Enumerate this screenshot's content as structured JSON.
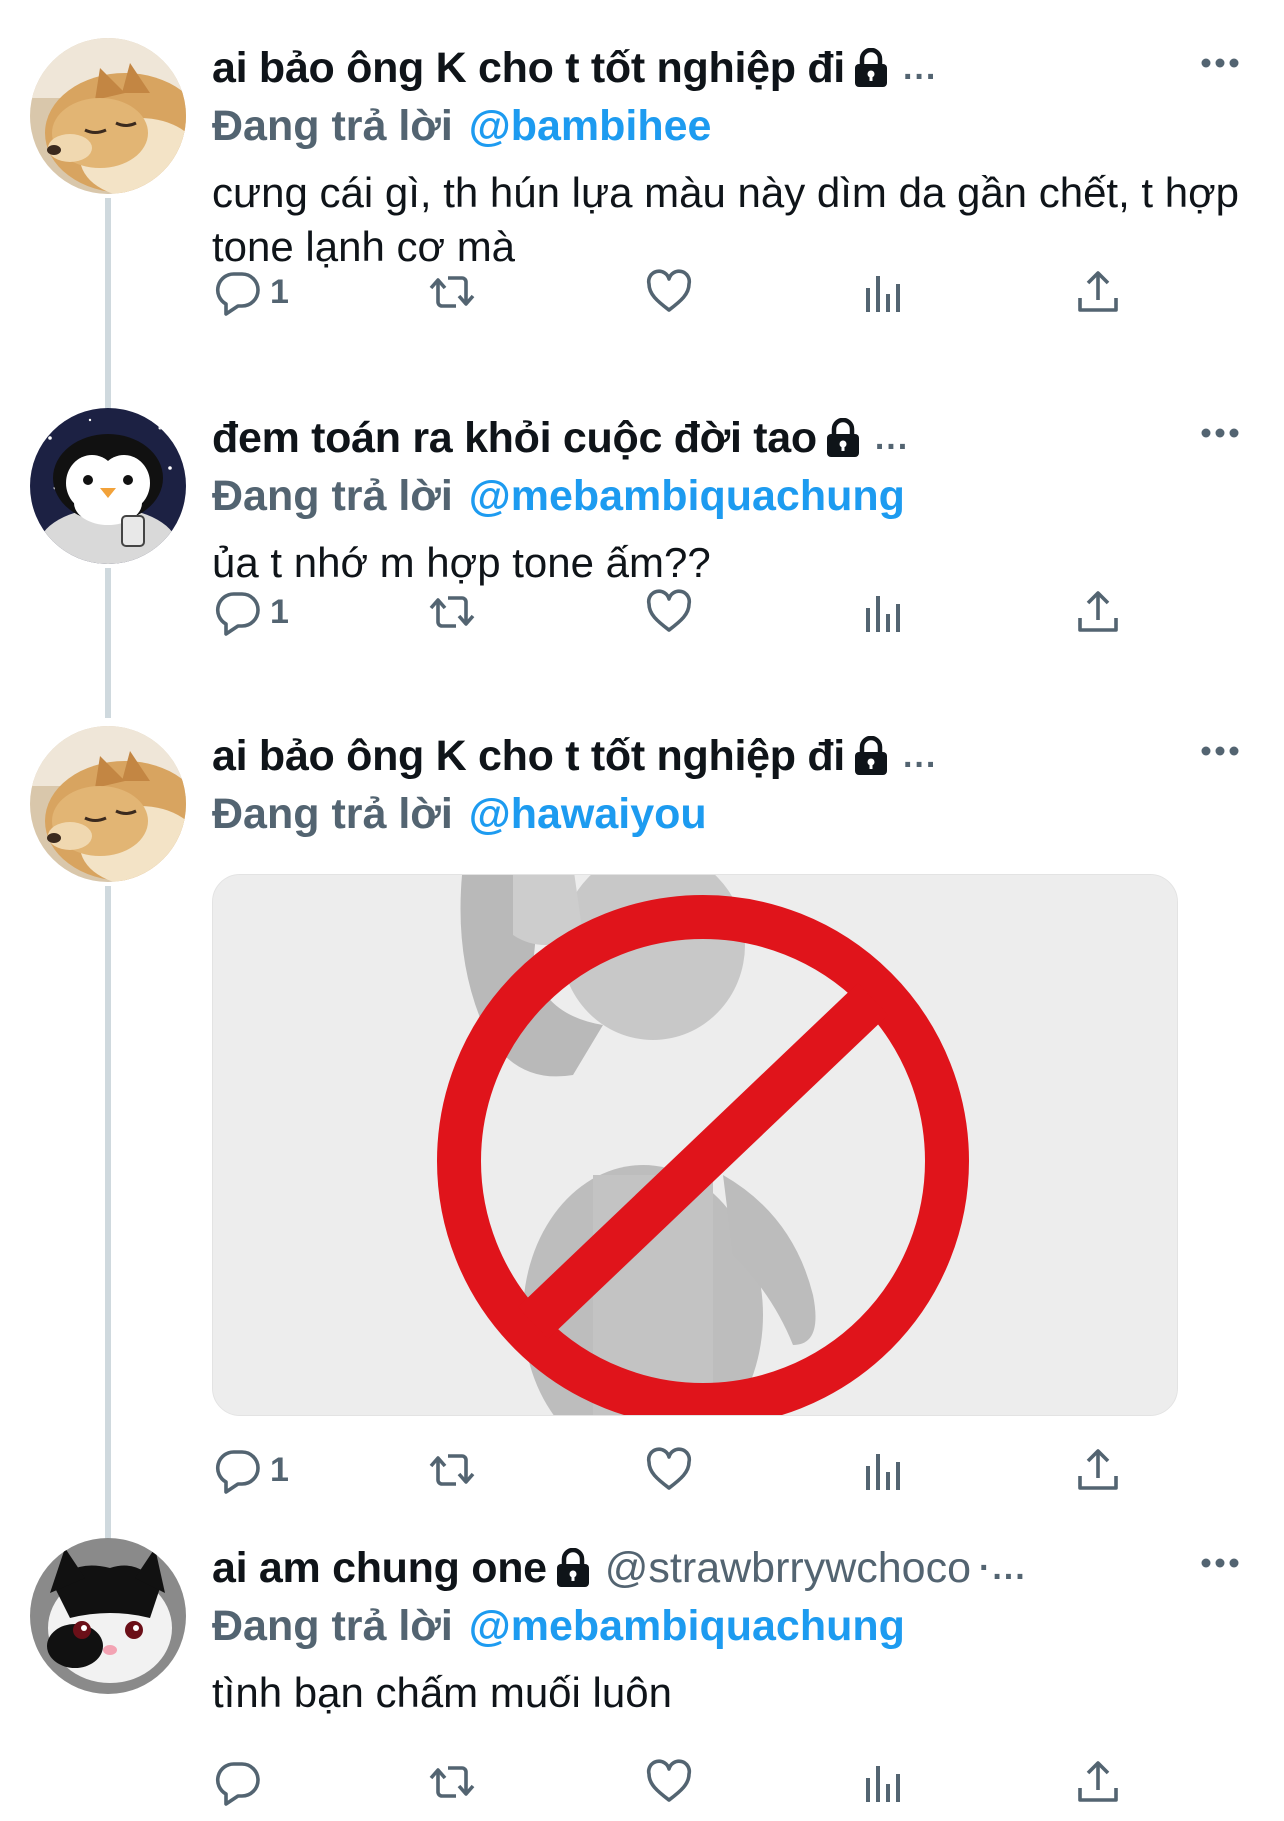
{
  "tweets": [
    {
      "display_name": "ai bảo ông K cho t tốt nghiệp đi",
      "handle": "",
      "truncation": "...",
      "reply_label": "Đang trả lời",
      "reply_to": "@bambihee",
      "text": "cưng cái gì, th hún lựa màu này dìm da gần chết, t hợp tone lạnh cơ mà",
      "reply_count": "1",
      "avatar_icon": "shiba-dog-avatar"
    },
    {
      "display_name": "đem toán ra khỏi cuộc đời tao",
      "handle": "",
      "truncation": "...",
      "reply_label": "Đang trả lời",
      "reply_to": "@mebambiquachung",
      "text": "ủa t nhớ m hợp tone ấm??",
      "reply_count": "1",
      "avatar_icon": "penguin-avatar"
    },
    {
      "display_name": "ai bảo ông K cho t tốt nghiệp đi",
      "handle": "",
      "truncation": "...",
      "reply_label": "Đang trả lời",
      "reply_to": "@hawaiyou",
      "text": "",
      "media_icon": "no-entry-stop-figure-image",
      "reply_count": "1",
      "avatar_icon": "shiba-dog-avatar"
    },
    {
      "display_name": "ai am chung one",
      "handle": "@strawbrrywchoco",
      "truncation": "·...",
      "reply_label": "Đang trả lời",
      "reply_to": "@mebambiquachung",
      "text": "tình bạn chấm muối luôn",
      "reply_count": "",
      "avatar_icon": "black-white-cat-avatar"
    }
  ],
  "colors": {
    "accent": "#1d9bf0",
    "secondary_text": "#536471",
    "thread_line": "#cfd9de",
    "stop_red": "#e0141b"
  },
  "action_icons": [
    "reply-icon",
    "retweet-icon",
    "like-icon",
    "views-icon",
    "share-icon"
  ]
}
